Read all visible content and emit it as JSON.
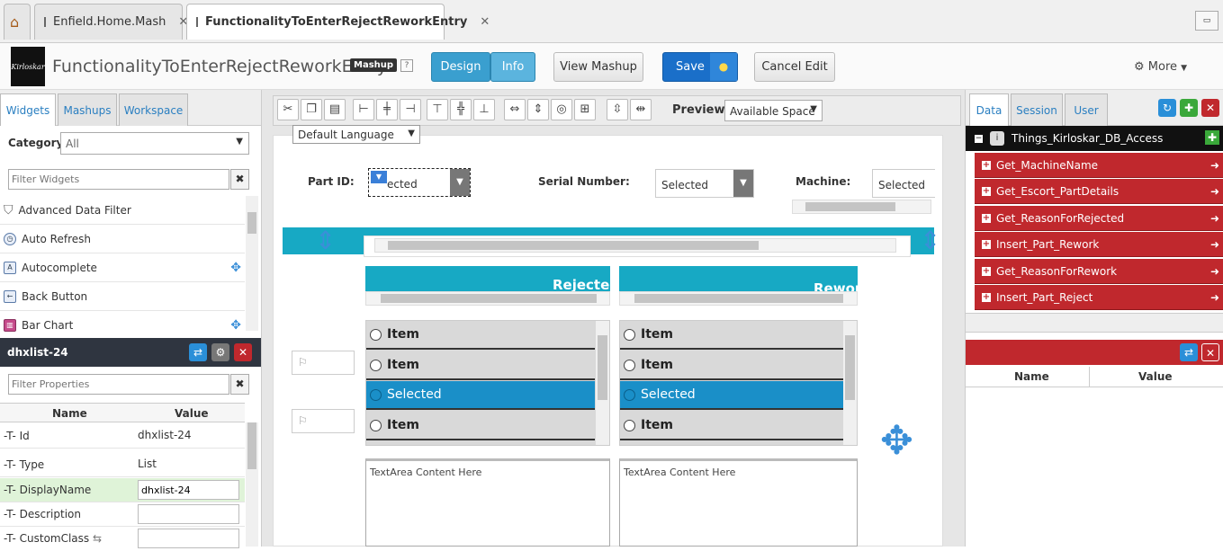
{
  "tabs": {
    "home_label": "",
    "tab1": "Enfield.Home.Mash",
    "tab2": "FunctionalityToEnterRejectReworkEntry"
  },
  "header": {
    "logo_text": "Kirloskar",
    "title": "FunctionalityToEnterRejectReworkEntry",
    "badge": "Mashup",
    "help": "?",
    "design": "Design",
    "info": "Info",
    "view_mashup": "View Mashup",
    "save": "Save",
    "cancel_edit": "Cancel Edit",
    "more": "More"
  },
  "left": {
    "tabs": [
      "Widgets",
      "Mashups",
      "Workspace"
    ],
    "category_label": "Category",
    "category_value": "All",
    "filter_widgets_placeholder": "Filter Widgets",
    "widgets": [
      "Advanced Data Filter",
      "Auto Refresh",
      "Autocomplete",
      "Back Button",
      "Bar Chart"
    ],
    "props_title": "dhxlist-24",
    "filter_props_placeholder": "Filter Properties",
    "col_name": "Name",
    "col_value": "Value",
    "props": [
      {
        "name": "Id",
        "value": "dhxlist-24"
      },
      {
        "name": "Type",
        "value": "List"
      },
      {
        "name": "DisplayName",
        "value": "dhxlist-24"
      },
      {
        "name": "Description",
        "value": ""
      },
      {
        "name": "CustomClass",
        "value": ""
      }
    ]
  },
  "toolbar": {
    "preview": "Preview",
    "preview_option": "Available Space",
    "language": "Default Language"
  },
  "canvas": {
    "part_id_label": "Part ID:",
    "part_id_value": "ected",
    "serial_label": "Serial Number:",
    "serial_value": "Selected",
    "machine_label": "Machine:",
    "machine_value": "Selected",
    "rejected_header": "Rejected",
    "rework_header": "Rewor",
    "list_items": [
      "Item",
      "Item",
      "Selected",
      "Item"
    ],
    "textarea": "TextArea Content Here"
  },
  "right": {
    "tabs": [
      "Data",
      "Session",
      "User"
    ],
    "thing": "Things_Kirloskar_DB_Access",
    "services": [
      "Get_MachineName",
      "Get_Escort_PartDetails",
      "Get_ReasonForRejected",
      "Insert_Part_Rework",
      "Get_ReasonForRework",
      "Insert_Part_Reject"
    ],
    "col_name": "Name",
    "col_value": "Value"
  },
  "colors": {
    "accent": "#1a8fc8",
    "service": "#c0282d",
    "teal": "#17a9c4"
  }
}
